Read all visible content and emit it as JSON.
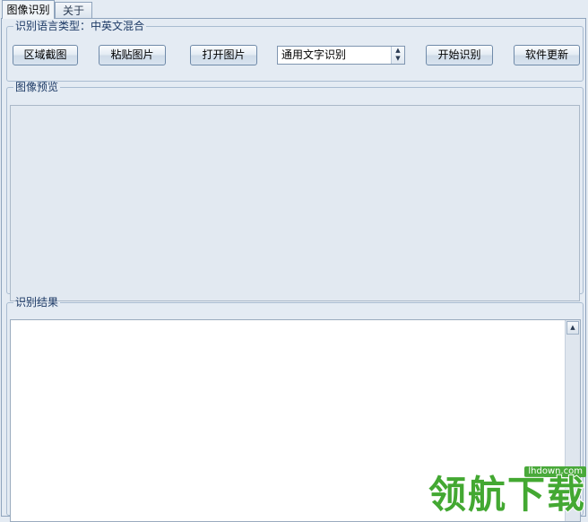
{
  "tabs": [
    {
      "label": "图像识别",
      "active": true
    },
    {
      "label": "关于",
      "active": false
    }
  ],
  "language_group": {
    "legend": "识别语言类型：中英文混合"
  },
  "toolbar": {
    "region_capture_label": "区域截图",
    "paste_image_label": "粘贴图片",
    "open_image_label": "打开图片",
    "start_recognition_label": "开始识别",
    "software_update_label": "软件更新"
  },
  "recognition_mode": {
    "selected": "通用文字识别"
  },
  "preview_group": {
    "legend": "图像预览"
  },
  "result_group": {
    "legend": "识别结果",
    "text": ""
  },
  "watermark": {
    "domain": "lhdown.com",
    "text": "领航下载"
  },
  "colors": {
    "background": "#e4ebf3",
    "group_border": "#a9bcd1",
    "legend_text": "#1d3a66",
    "watermark_green": "#43a832"
  },
  "icons": {
    "dropdown": "spin-arrows-icon",
    "scroll_up": "scroll-up-arrow-icon"
  }
}
